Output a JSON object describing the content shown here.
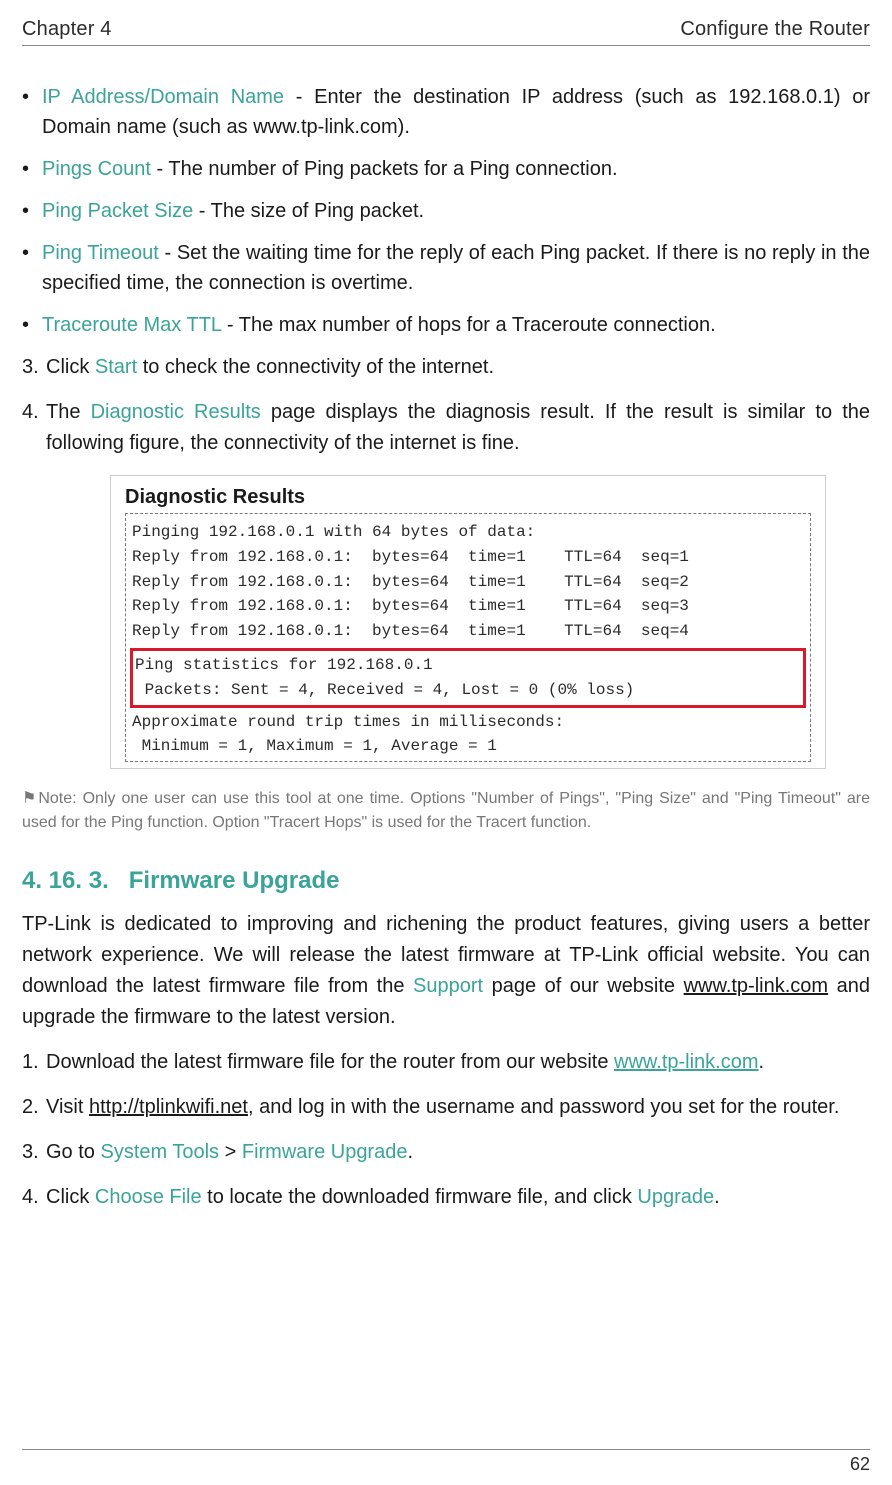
{
  "header": {
    "chapter": "Chapter 4",
    "title": "Configure the Router"
  },
  "bullets": [
    {
      "term": "IP Address/Domain Name",
      "text": " - Enter the destination IP address (such as 192.168.0.1) or Domain name (such as www.tp-link.com)."
    },
    {
      "term": "Pings Count",
      "text": " - The number of Ping packets for a Ping connection."
    },
    {
      "term": "Ping Packet Size",
      "text": " - The size of Ping packet."
    },
    {
      "term": "Ping Timeout",
      "text": " - Set the waiting time for the reply of each Ping packet. If there is no reply in the specified time, the connection is overtime."
    },
    {
      "term": "Traceroute Max TTL",
      "text": " - The max number of hops for a Traceroute connection."
    }
  ],
  "steps_a": {
    "item3_pre": "Click ",
    "item3_term": "Start",
    "item3_post": " to check the connectivity of the internet.",
    "item4_pre": "The ",
    "item4_term": "Diagnostic Results",
    "item4_post": " page displays the diagnosis result. If the result is similar to the following figure, the connectivity of the internet is fine."
  },
  "diag": {
    "title": "Diagnostic Results",
    "line1": "Pinging 192.168.0.1 with 64 bytes of data:",
    "blank1": "",
    "r1": "Reply from 192.168.0.1:  bytes=64  time=1    TTL=64  seq=1",
    "r2": "Reply from 192.168.0.1:  bytes=64  time=1    TTL=64  seq=2",
    "r3": "Reply from 192.168.0.1:  bytes=64  time=1    TTL=64  seq=3",
    "r4": "Reply from 192.168.0.1:  bytes=64  time=1    TTL=64  seq=4",
    "blank2": "",
    "stats1": "Ping statistics for 192.168.0.1",
    "stats2": " Packets: Sent = 4, Received = 4, Lost = 0 (0% loss)",
    "approx": "Approximate round trip times in milliseconds:",
    "minmax": " Minimum = 1, Maximum = 1, Average = 1"
  },
  "note": {
    "label": "Note:",
    "text": " Only one user can use this tool at one time. Options \"Number of Pings\", \"Ping Size\" and \"Ping Timeout\" are used for the Ping function. Option \"Tracert Hops\" is used for the Tracert function."
  },
  "section": {
    "num": "4. 16. 3.",
    "title": "Firmware Upgrade"
  },
  "para": {
    "p1_a": "TP-Link is dedicated to improving and richening the product features, giving users a better network experience. We will release the latest firmware at TP-Link official website. You can download the latest firmware file from the ",
    "p1_term": "Support",
    "p1_b": " page of our website ",
    "p1_link": "www.tp-link.com",
    "p1_c": " and upgrade the firmware to the latest version."
  },
  "steps_b": {
    "s1_a": "Download the latest firmware file for the router from our website ",
    "s1_link": "www.tp-link.com",
    "s1_b": ".",
    "s2_a": "Visit ",
    "s2_link": "http://tplinkwifi.net",
    "s2_b": ", and log in with the username and password you set for the router.",
    "s3_a": "Go to ",
    "s3_term1": "System Tools",
    "s3_mid": " > ",
    "s3_term2": "Firmware Upgrade",
    "s3_b": ".",
    "s4_a": "Click ",
    "s4_term1": "Choose File",
    "s4_mid": " to locate the downloaded firmware file, and click ",
    "s4_term2": "Upgrade",
    "s4_b": "."
  },
  "pagenum": "62"
}
